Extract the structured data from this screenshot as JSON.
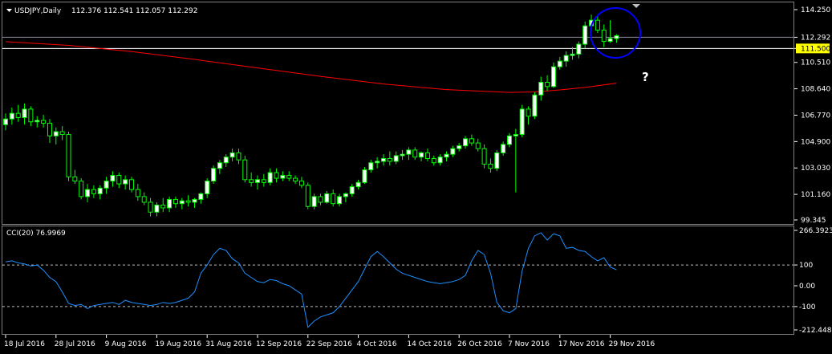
{
  "window": {
    "title": "USDJPY,Daily",
    "ohlc": "112.376 112.541 112.057 112.292",
    "indicator_title": "CCI(20) 76.9969",
    "annotation": "?"
  },
  "colors": {
    "background": "#000000",
    "grid": "#c0c0c0",
    "bull_body": "#00ff00",
    "bear_body": "#ffffff",
    "wick": "#00ff00",
    "ma_line": "#ff0000",
    "cci_line": "#1e90ff",
    "bid_line": "#9090a0",
    "level_line": "#ffffff",
    "level_badge": "#ffff00",
    "circle": "#0000ff"
  },
  "price_axis": {
    "labels": [
      "114.250",
      "112.292",
      "111.500",
      "110.510",
      "108.640",
      "106.770",
      "104.900",
      "103.030",
      "101.160",
      "99.345"
    ],
    "values": [
      114.25,
      112.292,
      111.5,
      110.51,
      108.64,
      106.77,
      104.9,
      103.03,
      101.16,
      99.345
    ],
    "current_price": 112.292,
    "level_price": 111.5
  },
  "cci_axis": {
    "labels": [
      "266.3923",
      "100",
      "0.00",
      "-100",
      "-212.4489"
    ],
    "values": [
      266.3923,
      100,
      0,
      -100,
      -212.4489
    ]
  },
  "time_axis": {
    "labels": [
      "18 Jul 2016",
      "28 Jul 2016",
      "9 Aug 2016",
      "19 Aug 2016",
      "31 Aug 2016",
      "12 Sep 2016",
      "22 Sep 2016",
      "4 Oct 2016",
      "14 Oct 2016",
      "26 Oct 2016",
      "7 Nov 2016",
      "17 Nov 2016",
      "29 Nov 2016"
    ],
    "indices": [
      0,
      8,
      16,
      24,
      32,
      40,
      48,
      56,
      64,
      72,
      80,
      88,
      96
    ]
  },
  "chart_data": [
    {
      "type": "candlestick",
      "title": "USDJPY,Daily",
      "ylim": [
        99.345,
        114.25
      ],
      "candles": [
        [
          106.1,
          106.9,
          105.7,
          106.5
        ],
        [
          106.5,
          107.3,
          106.1,
          106.9
        ],
        [
          106.9,
          107.5,
          106.3,
          106.6
        ],
        [
          106.6,
          107.6,
          106.1,
          107.2
        ],
        [
          107.2,
          107.4,
          106.0,
          106.3
        ],
        [
          106.3,
          106.7,
          105.9,
          106.4
        ],
        [
          106.4,
          106.8,
          105.9,
          106.2
        ],
        [
          106.2,
          106.5,
          104.8,
          105.3
        ],
        [
          105.3,
          105.9,
          104.7,
          105.6
        ],
        [
          105.6,
          106.0,
          105.0,
          105.4
        ],
        [
          105.4,
          105.6,
          102.1,
          102.4
        ],
        [
          102.4,
          102.9,
          101.9,
          102.1
        ],
        [
          102.1,
          102.3,
          100.8,
          101.0
        ],
        [
          101.0,
          101.9,
          100.6,
          101.5
        ],
        [
          101.5,
          101.8,
          100.9,
          101.2
        ],
        [
          101.2,
          101.8,
          100.8,
          101.6
        ],
        [
          101.6,
          102.4,
          101.2,
          102.1
        ],
        [
          102.1,
          102.8,
          101.7,
          102.5
        ],
        [
          102.5,
          102.7,
          101.6,
          101.9
        ],
        [
          101.9,
          102.5,
          101.5,
          102.2
        ],
        [
          102.2,
          102.4,
          101.3,
          101.5
        ],
        [
          101.5,
          101.9,
          100.7,
          101.0
        ],
        [
          101.0,
          101.3,
          100.4,
          100.6
        ],
        [
          100.6,
          100.9,
          99.6,
          99.9
        ],
        [
          99.9,
          100.6,
          99.6,
          100.4
        ],
        [
          100.4,
          100.9,
          99.9,
          100.2
        ],
        [
          100.2,
          101.0,
          99.9,
          100.8
        ],
        [
          100.8,
          101.0,
          100.2,
          100.5
        ],
        [
          100.5,
          100.9,
          100.1,
          100.7
        ],
        [
          100.7,
          101.1,
          100.3,
          100.6
        ],
        [
          100.6,
          100.9,
          100.2,
          100.8
        ],
        [
          100.8,
          101.3,
          100.5,
          101.2
        ],
        [
          101.2,
          102.3,
          100.9,
          102.1
        ],
        [
          102.1,
          103.2,
          101.9,
          103.0
        ],
        [
          103.0,
          103.6,
          102.6,
          103.4
        ],
        [
          103.4,
          104.0,
          103.1,
          103.8
        ],
        [
          103.8,
          104.4,
          103.5,
          104.1
        ],
        [
          104.1,
          104.4,
          103.3,
          103.6
        ],
        [
          103.6,
          103.9,
          102.0,
          102.2
        ],
        [
          102.2,
          102.7,
          101.7,
          102.0
        ],
        [
          102.0,
          102.5,
          101.5,
          102.2
        ],
        [
          102.2,
          102.6,
          101.7,
          102.0
        ],
        [
          102.0,
          103.0,
          101.8,
          102.7
        ],
        [
          102.7,
          103.0,
          102.0,
          102.3
        ],
        [
          102.3,
          102.8,
          102.1,
          102.5
        ],
        [
          102.5,
          102.8,
          102.1,
          102.3
        ],
        [
          102.3,
          102.5,
          101.9,
          102.1
        ],
        [
          102.1,
          102.4,
          101.6,
          101.8
        ],
        [
          101.8,
          102.0,
          100.1,
          100.3
        ],
        [
          100.3,
          101.2,
          100.1,
          101.0
        ],
        [
          101.0,
          101.2,
          100.4,
          100.6
        ],
        [
          100.6,
          101.4,
          100.5,
          101.2
        ],
        [
          101.2,
          101.5,
          100.3,
          100.5
        ],
        [
          100.5,
          101.2,
          100.3,
          101.0
        ],
        [
          101.0,
          101.3,
          100.6,
          101.2
        ],
        [
          101.2,
          101.9,
          101.0,
          101.7
        ],
        [
          101.7,
          102.2,
          101.5,
          102.0
        ],
        [
          102.0,
          103.1,
          101.9,
          102.9
        ],
        [
          102.9,
          103.6,
          102.7,
          103.4
        ],
        [
          103.4,
          103.8,
          103.0,
          103.5
        ],
        [
          103.5,
          104.0,
          103.2,
          103.7
        ],
        [
          103.7,
          104.2,
          103.2,
          103.5
        ],
        [
          103.5,
          104.2,
          103.3,
          103.9
        ],
        [
          103.9,
          104.3,
          103.6,
          104.0
        ],
        [
          104.0,
          104.5,
          103.6,
          104.3
        ],
        [
          104.3,
          104.5,
          103.6,
          103.8
        ],
        [
          103.8,
          104.2,
          103.5,
          104.1
        ],
        [
          104.1,
          104.4,
          103.5,
          103.7
        ],
        [
          103.7,
          103.9,
          103.2,
          103.4
        ],
        [
          103.4,
          104.0,
          103.2,
          103.8
        ],
        [
          103.8,
          104.2,
          103.5,
          104.0
        ],
        [
          104.0,
          104.6,
          103.8,
          104.4
        ],
        [
          104.4,
          104.8,
          104.2,
          104.6
        ],
        [
          104.6,
          105.3,
          104.4,
          105.1
        ],
        [
          105.1,
          105.4,
          104.6,
          104.8
        ],
        [
          104.8,
          105.1,
          104.2,
          104.4
        ],
        [
          104.4,
          104.7,
          103.0,
          103.3
        ],
        [
          103.3,
          103.7,
          102.7,
          103.0
        ],
        [
          103.0,
          104.3,
          102.8,
          104.1
        ],
        [
          104.1,
          104.9,
          103.9,
          104.7
        ],
        [
          104.7,
          105.5,
          104.5,
          105.3
        ],
        [
          105.3,
          105.8,
          101.3,
          105.4
        ],
        [
          105.4,
          107.5,
          105.2,
          107.2
        ],
        [
          107.2,
          107.4,
          106.1,
          106.7
        ],
        [
          106.7,
          108.4,
          106.5,
          108.2
        ],
        [
          108.2,
          109.5,
          107.8,
          109.1
        ],
        [
          109.1,
          109.6,
          108.5,
          108.8
        ],
        [
          108.8,
          110.5,
          108.7,
          110.2
        ],
        [
          110.2,
          110.9,
          110.0,
          110.6
        ],
        [
          110.6,
          111.3,
          110.2,
          111.0
        ],
        [
          111.0,
          111.6,
          110.7,
          111.1
        ],
        [
          111.1,
          112.0,
          110.8,
          111.8
        ],
        [
          111.8,
          113.4,
          111.5,
          113.1
        ],
        [
          113.1,
          113.9,
          112.8,
          113.5
        ],
        [
          113.5,
          113.8,
          112.6,
          112.8
        ],
        [
          112.8,
          113.2,
          111.6,
          112.0
        ],
        [
          112.0,
          113.5,
          111.9,
          112.2
        ],
        [
          112.2,
          112.5,
          111.9,
          112.4
        ]
      ],
      "ma": [
        [
          0,
          111.98
        ],
        [
          10,
          111.72
        ],
        [
          20,
          111.28
        ],
        [
          30,
          110.72
        ],
        [
          40,
          110.12
        ],
        [
          50,
          109.52
        ],
        [
          60,
          108.98
        ],
        [
          70,
          108.58
        ],
        [
          80,
          108.38
        ],
        [
          84,
          108.42
        ],
        [
          88,
          108.56
        ],
        [
          92,
          108.74
        ],
        [
          97,
          109.04
        ]
      ]
    },
    {
      "type": "line",
      "title": "CCI(20) 76.9969",
      "ylim": [
        -212.4489,
        266.3923
      ],
      "values": [
        115,
        120,
        110,
        105,
        95,
        100,
        75,
        40,
        20,
        -30,
        -85,
        -95,
        -90,
        -110,
        -95,
        -90,
        -85,
        -80,
        -90,
        -70,
        -80,
        -85,
        -90,
        -95,
        -90,
        -80,
        -85,
        -80,
        -70,
        -60,
        -30,
        60,
        100,
        150,
        180,
        170,
        130,
        110,
        60,
        40,
        20,
        15,
        30,
        25,
        10,
        0,
        -20,
        -40,
        -200,
        -170,
        -150,
        -140,
        -130,
        -100,
        -60,
        -20,
        20,
        80,
        140,
        165,
        140,
        110,
        80,
        60,
        50,
        40,
        30,
        20,
        15,
        10,
        15,
        20,
        30,
        50,
        120,
        170,
        150,
        60,
        -80,
        -120,
        -130,
        -110,
        70,
        180,
        240,
        255,
        220,
        250,
        240,
        180,
        185,
        170,
        165,
        140,
        120,
        135,
        90,
        77
      ]
    }
  ]
}
